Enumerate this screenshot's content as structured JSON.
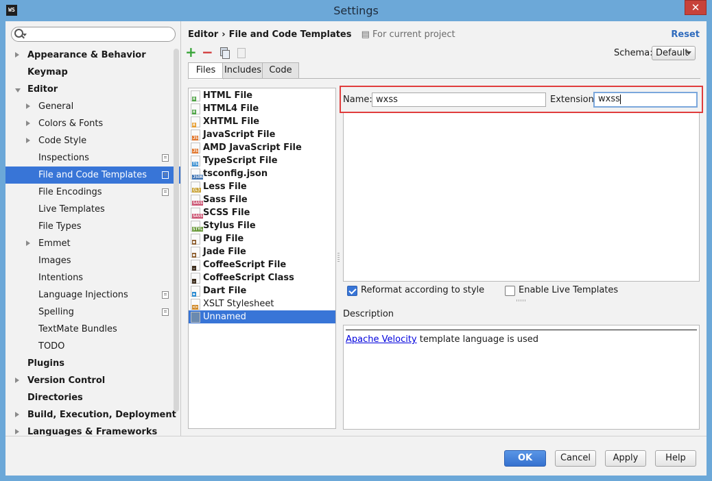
{
  "window": {
    "title": "Settings",
    "app_icon": "WS",
    "close_glyph": "✕"
  },
  "search": {
    "placeholder": "",
    "value": ""
  },
  "sidebar": {
    "items": [
      {
        "label": "Appearance & Behavior",
        "level": 0,
        "bold": true,
        "arrow": "right",
        "proj": false
      },
      {
        "label": "Keymap",
        "level": 0,
        "bold": true,
        "arrow": "none",
        "proj": false
      },
      {
        "label": "Editor",
        "level": 0,
        "bold": true,
        "arrow": "down",
        "proj": false
      },
      {
        "label": "General",
        "level": 1,
        "bold": false,
        "arrow": "right",
        "proj": false
      },
      {
        "label": "Colors & Fonts",
        "level": 1,
        "bold": false,
        "arrow": "right",
        "proj": false
      },
      {
        "label": "Code Style",
        "level": 1,
        "bold": false,
        "arrow": "right",
        "proj": false
      },
      {
        "label": "Inspections",
        "level": 1,
        "bold": false,
        "arrow": "none",
        "proj": true
      },
      {
        "label": "File and Code Templates",
        "level": 1,
        "bold": false,
        "arrow": "none",
        "proj": true,
        "selected": true
      },
      {
        "label": "File Encodings",
        "level": 1,
        "bold": false,
        "arrow": "none",
        "proj": true
      },
      {
        "label": "Live Templates",
        "level": 1,
        "bold": false,
        "arrow": "none",
        "proj": false
      },
      {
        "label": "File Types",
        "level": 1,
        "bold": false,
        "arrow": "none",
        "proj": false
      },
      {
        "label": "Emmet",
        "level": 1,
        "bold": false,
        "arrow": "right",
        "proj": false
      },
      {
        "label": "Images",
        "level": 1,
        "bold": false,
        "arrow": "none",
        "proj": false
      },
      {
        "label": "Intentions",
        "level": 1,
        "bold": false,
        "arrow": "none",
        "proj": false
      },
      {
        "label": "Language Injections",
        "level": 1,
        "bold": false,
        "arrow": "none",
        "proj": true
      },
      {
        "label": "Spelling",
        "level": 1,
        "bold": false,
        "arrow": "none",
        "proj": true
      },
      {
        "label": "TextMate Bundles",
        "level": 1,
        "bold": false,
        "arrow": "none",
        "proj": false
      },
      {
        "label": "TODO",
        "level": 1,
        "bold": false,
        "arrow": "none",
        "proj": false
      },
      {
        "label": "Plugins",
        "level": 0,
        "bold": true,
        "arrow": "none",
        "proj": false
      },
      {
        "label": "Version Control",
        "level": 0,
        "bold": true,
        "arrow": "right",
        "proj": false
      },
      {
        "label": "Directories",
        "level": 0,
        "bold": true,
        "arrow": "none",
        "proj": false
      },
      {
        "label": "Build, Execution, Deployment",
        "level": 0,
        "bold": true,
        "arrow": "right",
        "proj": false
      },
      {
        "label": "Languages & Frameworks",
        "level": 0,
        "bold": true,
        "arrow": "right",
        "proj": false
      }
    ]
  },
  "header": {
    "crumb1": "Editor",
    "crumb_sep": "›",
    "crumb2": "File and Code Templates",
    "scope": "For current project",
    "reset": "Reset"
  },
  "schema": {
    "label": "Schema:",
    "value": "Default"
  },
  "tabs": [
    {
      "label": "Files",
      "active": true
    },
    {
      "label": "Includes",
      "active": false
    },
    {
      "label": "Code",
      "active": false
    }
  ],
  "files": [
    {
      "name": "HTML File",
      "bold": true,
      "tag": "H",
      "color": "#4aa040"
    },
    {
      "name": "HTML4 File",
      "bold": true,
      "tag": "H",
      "color": "#4aa040"
    },
    {
      "name": "XHTML File",
      "bold": true,
      "tag": "H",
      "color": "#e59a2a"
    },
    {
      "name": "JavaScript File",
      "bold": true,
      "tag": "JS",
      "color": "#e0742a"
    },
    {
      "name": "AMD JavaScript File",
      "bold": true,
      "tag": "JS",
      "color": "#e0742a"
    },
    {
      "name": "TypeScript File",
      "bold": true,
      "tag": "TS",
      "color": "#3a8fd0"
    },
    {
      "name": "tsconfig.json",
      "bold": true,
      "tag": "JSON",
      "color": "#3a6fb0"
    },
    {
      "name": "Less File",
      "bold": true,
      "tag": "{L}",
      "color": "#c9a43a"
    },
    {
      "name": "Sass File",
      "bold": true,
      "tag": "SASS",
      "color": "#c84a6a"
    },
    {
      "name": "SCSS File",
      "bold": true,
      "tag": "SASS",
      "color": "#c84a6a"
    },
    {
      "name": "Stylus File",
      "bold": true,
      "tag": "STYL",
      "color": "#6a9a3a"
    },
    {
      "name": "Pug File",
      "bold": true,
      "tag": "●",
      "color": "#8a5a2a"
    },
    {
      "name": "Jade File",
      "bold": true,
      "tag": "●",
      "color": "#8a5a2a"
    },
    {
      "name": "CoffeeScript File",
      "bold": true,
      "tag": "☕",
      "color": "#3a2a1a"
    },
    {
      "name": "CoffeeScript Class",
      "bold": true,
      "tag": "☕",
      "color": "#3a2a1a"
    },
    {
      "name": "Dart File",
      "bold": true,
      "tag": "◆",
      "color": "#2a8ad0"
    },
    {
      "name": "XSLT Stylesheet",
      "bold": false,
      "tag": "<>",
      "color": "#d08a2a"
    },
    {
      "name": "Unnamed",
      "bold": false,
      "tag": "",
      "color": "#6a8ab0",
      "selected": true
    }
  ],
  "form": {
    "name_label": "Name:",
    "name_value": "wxss",
    "ext_label": "Extension:",
    "ext_value": "wxss"
  },
  "options": {
    "reformat": {
      "label": "Reformat according to style",
      "checked": true
    },
    "live": {
      "label": "Enable Live Templates",
      "checked": false
    }
  },
  "description": {
    "label": "Description",
    "link": "Apache Velocity",
    "text": " template language is used"
  },
  "buttons": {
    "ok": "OK",
    "cancel": "Cancel",
    "apply": "Apply",
    "help": "Help"
  }
}
